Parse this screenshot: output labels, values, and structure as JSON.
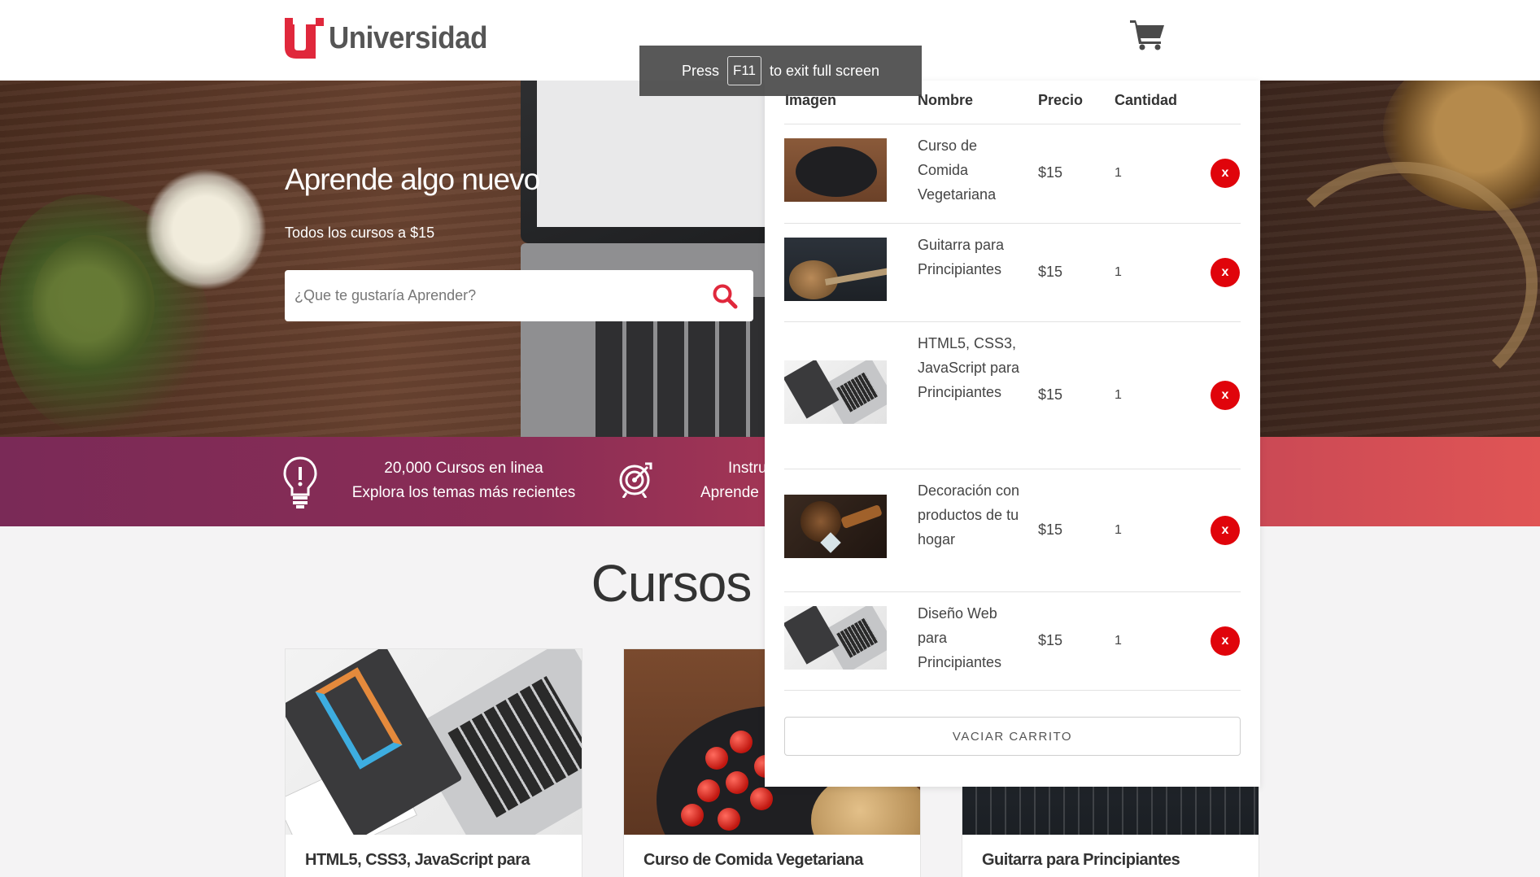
{
  "header": {
    "brand": "Universidad",
    "brand_color": "#e0283c",
    "cart_icon": "shopping-cart-icon"
  },
  "hero": {
    "title": "Aprende algo nuevo",
    "subtitle": "Todos los cursos a $15",
    "search_placeholder": "¿Que te gustaría Aprender?"
  },
  "stats_bar": {
    "item1_line1": "20,000 Cursos en linea",
    "item1_line2": "Explora los temas más recientes",
    "item2_line1": "Instru",
    "item2_line2": "Aprende"
  },
  "courses": {
    "title": "Cursos",
    "cards": [
      {
        "title": "HTML5, CSS3, JavaScript para"
      },
      {
        "title": "Curso de Comida Vegetariana"
      },
      {
        "title": "Guitarra para Principiantes"
      }
    ]
  },
  "fullscreen_toast": {
    "press": "Press",
    "key": "F11",
    "rest": "to exit full screen"
  },
  "cart": {
    "headers": {
      "image": "Imagen",
      "name": "Nombre",
      "price": "Precio",
      "quantity": "Cantidad"
    },
    "items": [
      {
        "name": "Curso de Comida Vegetariana",
        "price": "$15",
        "quantity": "1",
        "remove": "x"
      },
      {
        "name": "Guitarra para Principiantes",
        "price": "$15",
        "quantity": "1",
        "remove": "x"
      },
      {
        "name": "HTML5, CSS3, JavaScript para Principiantes",
        "price": "$15",
        "quantity": "1",
        "remove": "x"
      },
      {
        "name": "Decoración con productos de tu hogar",
        "price": "$15",
        "quantity": "1",
        "remove": "x"
      },
      {
        "name": "Diseño Web para Principiantes",
        "price": "$15",
        "quantity": "1",
        "remove": "x"
      }
    ],
    "empty_button": "VACIAR CARRITO"
  }
}
